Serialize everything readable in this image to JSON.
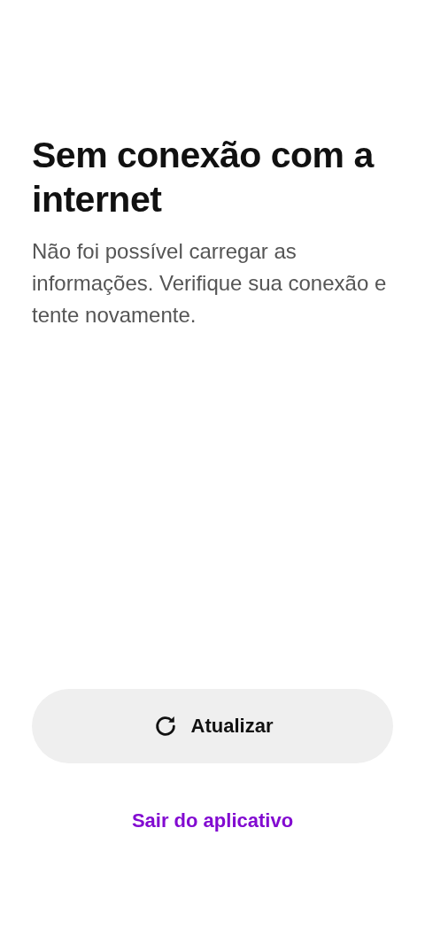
{
  "title": "Sem conexão com a internet",
  "message": "Não foi possível carregar as informações. Verifique sua conexão e tente novamente.",
  "refresh_button": {
    "label": "Atualizar"
  },
  "exit_link": {
    "label": "Sair do aplicativo"
  }
}
